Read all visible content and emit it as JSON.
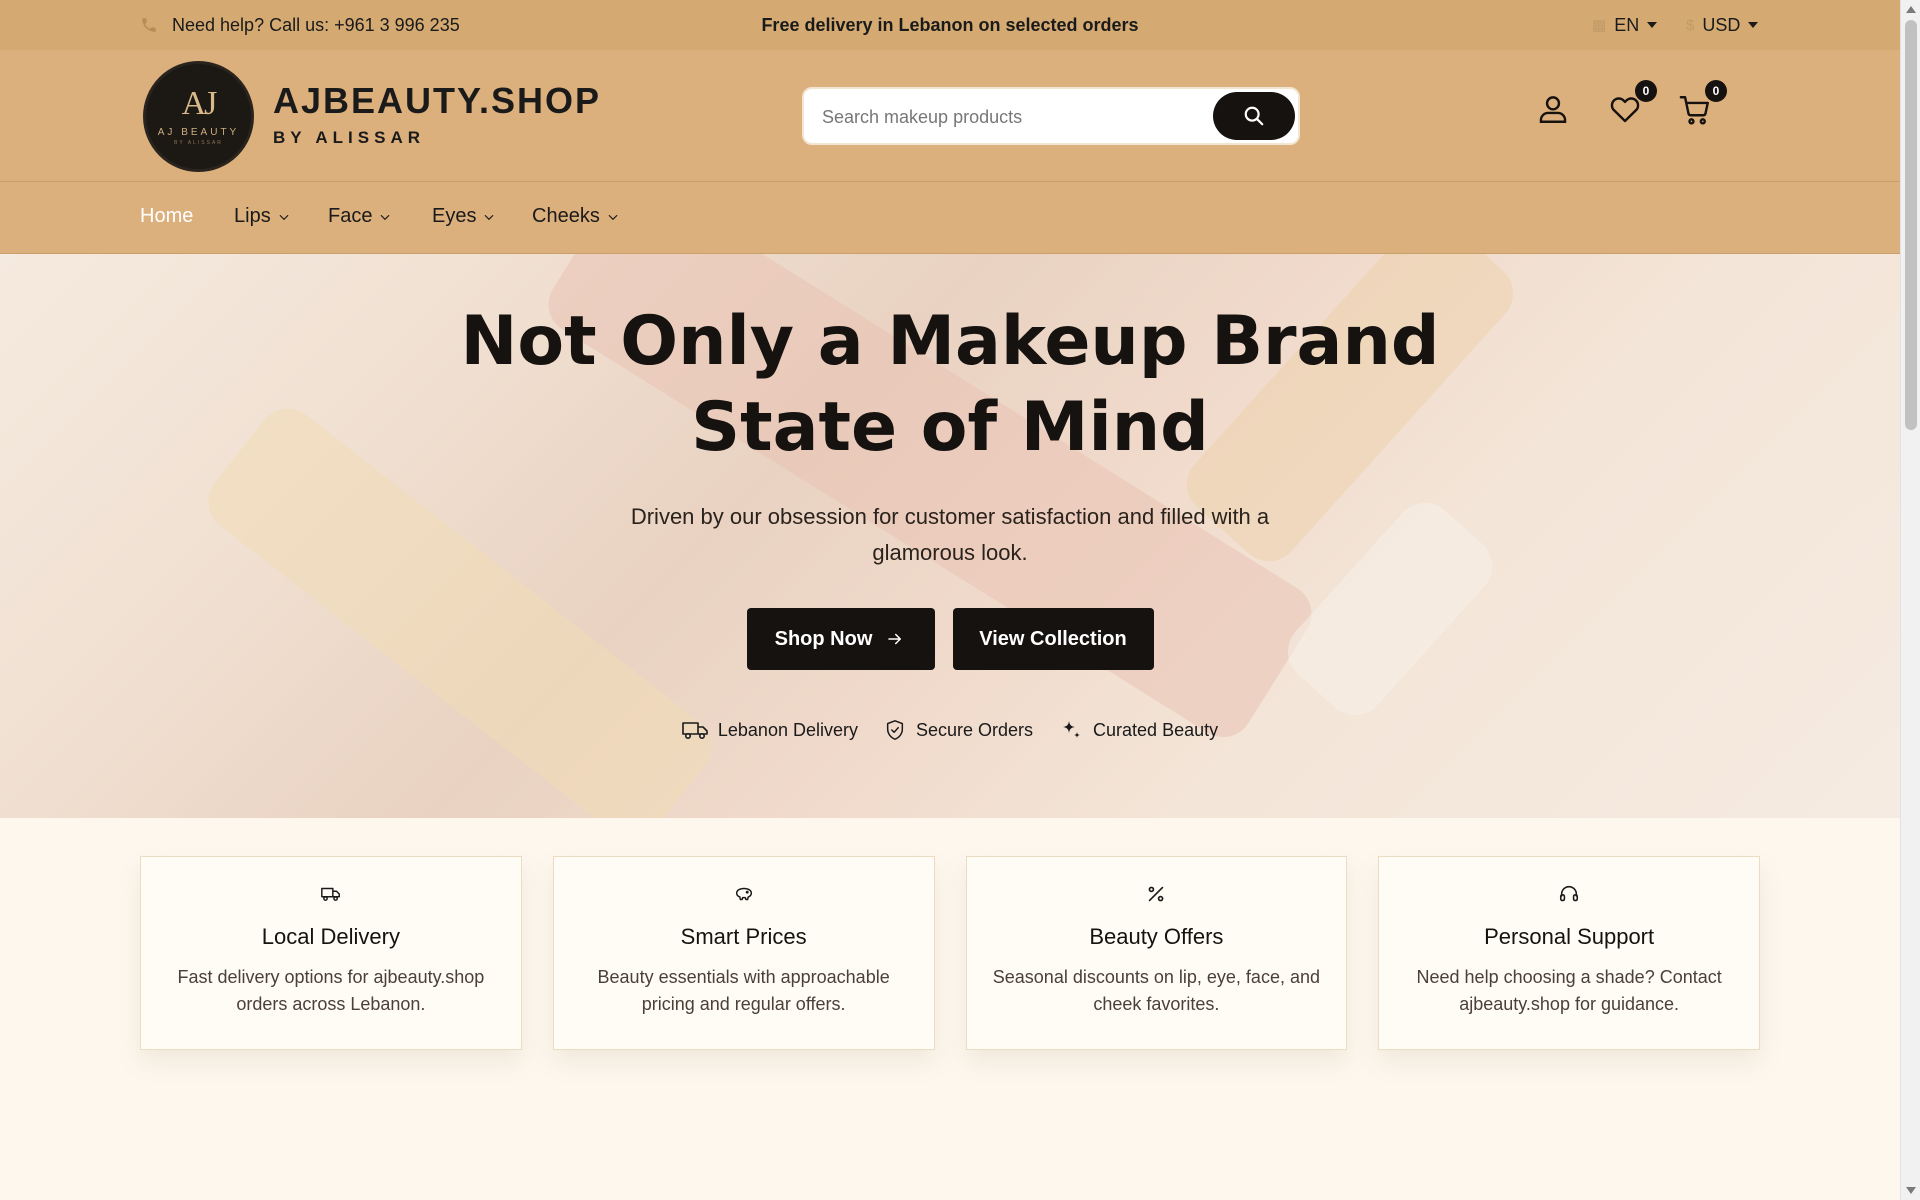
{
  "topbar": {
    "help_text": "Need help? Call us: +961 3 996 235",
    "promo": "Free delivery in Lebanon on selected orders",
    "language": "EN",
    "currency": "USD"
  },
  "header": {
    "logo_monogram": "AJ",
    "logo_label": "AJ BEAUTY",
    "logo_sublabel": "BY ALISSAR",
    "brand_name": "AJBEAUTY.SHOP",
    "brand_by": "BY ALISSAR",
    "search_placeholder": "Search makeup products",
    "wishlist_count": "0",
    "cart_count": "0"
  },
  "nav": {
    "items": [
      {
        "label": "Home"
      },
      {
        "label": "Lips"
      },
      {
        "label": "Face"
      },
      {
        "label": "Eyes"
      },
      {
        "label": "Cheeks"
      }
    ]
  },
  "hero": {
    "title_line1": "Not Only a Makeup Brand",
    "title_line2": "State of Mind",
    "subtitle": "Driven by our obsession for customer satisfaction and filled with a glamorous look.",
    "cta_primary": "Shop Now",
    "cta_secondary": "View Collection",
    "badges": [
      {
        "label": "Lebanon Delivery",
        "icon": "truck-icon"
      },
      {
        "label": "Secure Orders",
        "icon": "shield-check-icon"
      },
      {
        "label": "Curated Beauty",
        "icon": "sparkle-icon"
      }
    ]
  },
  "features": [
    {
      "title": "Local Delivery",
      "desc": "Fast delivery options for ajbeauty.shop orders across Lebanon.",
      "icon": "truck-icon"
    },
    {
      "title": "Smart Prices",
      "desc": "Beauty essentials with approachable pricing and regular offers.",
      "icon": "piggy-bank-icon"
    },
    {
      "title": "Beauty Offers",
      "desc": "Seasonal discounts on lip, eye, face, and cheek favorites.",
      "icon": "percent-icon"
    },
    {
      "title": "Personal Support",
      "desc": "Need help choosing a shade? Contact ajbeauty.shop for guidance.",
      "icon": "headset-icon"
    }
  ],
  "colors": {
    "topbar_bg": "#d4aa72",
    "header_bg": "#dcb07c",
    "accent_dark": "#161210",
    "page_bg": "#fdf7ee"
  }
}
